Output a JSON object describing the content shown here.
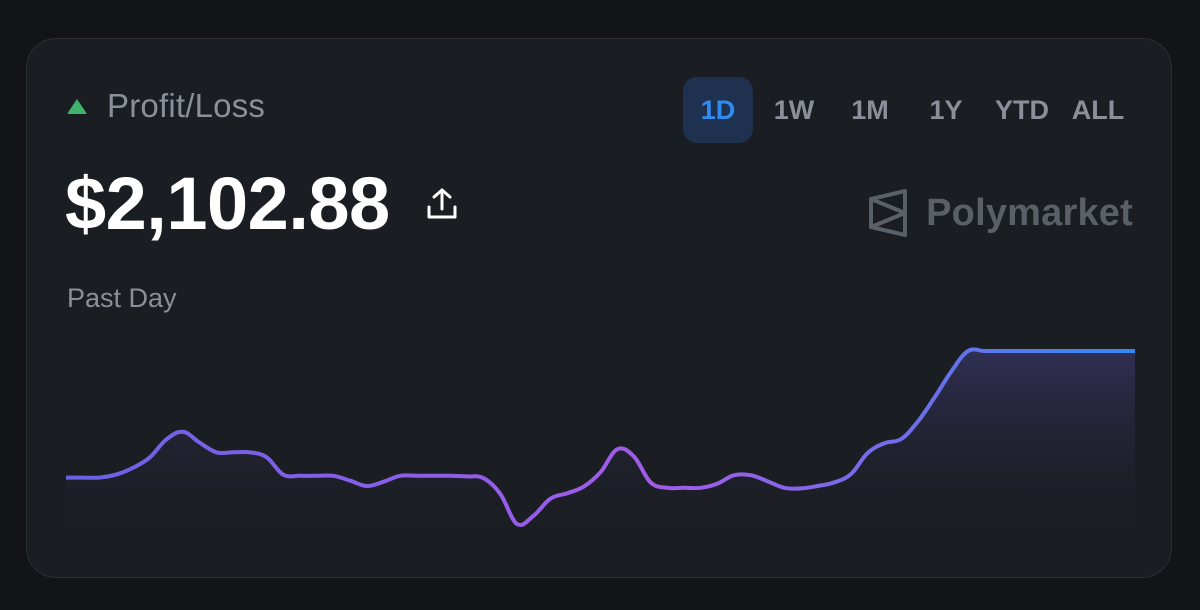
{
  "header": {
    "label": "Profit/Loss",
    "trend_icon": "triangle-up-icon",
    "trend_color": "#3fb56b"
  },
  "range_tabs": [
    {
      "label": "1D",
      "active": true
    },
    {
      "label": "1W",
      "active": false
    },
    {
      "label": "1M",
      "active": false
    },
    {
      "label": "1Y",
      "active": false
    },
    {
      "label": "YTD",
      "active": false
    },
    {
      "label": "ALL",
      "active": false
    }
  ],
  "amount": "$2,102.88",
  "share_icon": "share-upload-icon",
  "brand": {
    "name": "Polymarket",
    "logo_icon": "polymarket-logo-icon"
  },
  "period_label": "Past Day",
  "colors": {
    "accent_blue": "#2f8bf0",
    "line_purple": "#a25ce8",
    "line_blue": "#3388f2"
  },
  "chart_data": {
    "type": "area",
    "x": [
      0,
      1,
      2,
      3,
      4,
      5,
      6,
      7,
      8,
      9,
      10,
      11,
      12,
      13,
      14,
      15,
      16,
      17,
      18,
      19,
      20,
      21,
      22,
      23,
      24,
      25,
      26,
      27,
      28,
      29,
      30,
      31,
      32,
      33,
      34,
      35,
      36,
      37,
      38,
      39,
      40,
      41,
      42,
      43,
      44,
      45,
      46,
      47,
      48,
      49,
      50,
      51,
      52,
      53,
      54,
      55,
      56,
      57,
      58,
      59,
      60,
      61,
      62,
      63,
      64
    ],
    "values": [
      0.0,
      0.0,
      0.0,
      0.5,
      1.6,
      3.3,
      6.3,
      7.6,
      5.8,
      4.2,
      4.2,
      4.2,
      3.4,
      0.5,
      0.3,
      0.3,
      0.3,
      -0.5,
      -1.4,
      -0.7,
      0.3,
      0.3,
      0.3,
      0.3,
      0.2,
      -0.1,
      -2.7,
      -7.7,
      -6.3,
      -3.5,
      -2.6,
      -1.5,
      0.9,
      4.7,
      3.5,
      -0.8,
      -1.7,
      -1.7,
      -1.7,
      -1.0,
      0.4,
      0.4,
      -0.6,
      -1.7,
      -1.8,
      -1.4,
      -0.8,
      0.6,
      4.1,
      5.7,
      6.4,
      9.3,
      13.3,
      17.6,
      21.0,
      21.0,
      21.0,
      21.0,
      21.0,
      21.0,
      21.0,
      21.0,
      21.0,
      21.0,
      21.0
    ],
    "xlabel": "",
    "ylabel": "",
    "grid": false,
    "smooth": true
  }
}
